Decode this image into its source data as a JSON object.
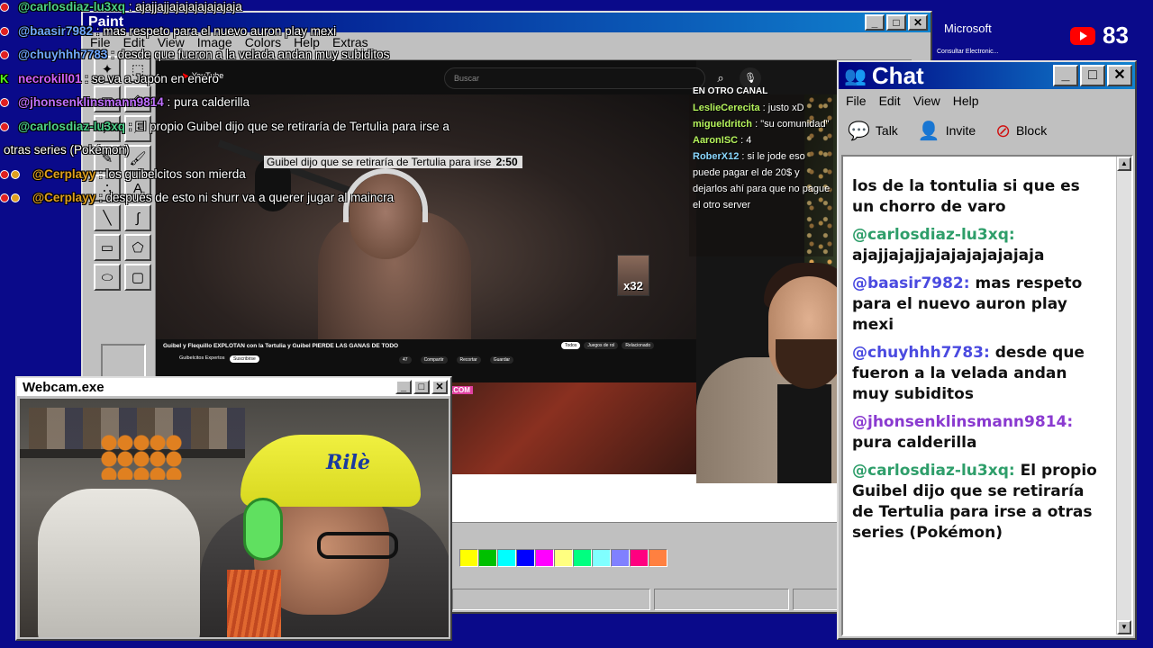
{
  "overlay_chat": [
    {
      "badge": "yt",
      "user": "@carlosdiaz-lu3xq",
      "user_color": "#4dd08a",
      "sep": " : ",
      "text": "ajajjajjajajajajajajaja"
    },
    {
      "badge": "yt",
      "user": "@baasir7982",
      "user_color": "#6fa8ff",
      "sep": " : ",
      "text": "mas respeto para el nuevo auron play mexi"
    },
    {
      "badge": "yt",
      "user": "@chuyhhh7783",
      "user_color": "#6fa8ff",
      "sep": " : ",
      "text": "desde que fueron a la velada andan muy subiditos"
    },
    {
      "badge": "kick",
      "user": "necrokill01",
      "user_color": "#d060ff",
      "sep": " : ",
      "text": "se va a Japón en enero"
    },
    {
      "badge": "yt",
      "user": "@jhonsenklinsmann9814",
      "user_color": "#c070ff",
      "sep": " : ",
      "text": "pura calderilla"
    },
    {
      "badge": "yt",
      "user": "@carlosdiaz-lu3xq",
      "user_color": "#4dd08a",
      "sep": " : ",
      "text": "El propio Guibel dijo que se retiraría de Tertulia para irse a"
    },
    {
      "badge": "none",
      "user": "",
      "user_color": "#ffffff",
      "sep": "",
      "text": "otras series (Pokémon)"
    },
    {
      "badge": "yt2",
      "user": "@Cerplayy",
      "user_color": "#e0a020",
      "sep": " : ",
      "text": "los guibelcitos son mierda"
    },
    {
      "badge": "yt2",
      "user": "@Cerplayy",
      "user_color": "#e0a020",
      "sep": " : ",
      "text": "después de esto ni shurr va a querer jugar al maincra"
    }
  ],
  "paint": {
    "title": "Paint",
    "menu": [
      "File",
      "Edit",
      "View",
      "Image",
      "Colors",
      "Help",
      "Extras"
    ],
    "palette": [
      "#ffff00",
      "#00c000",
      "#00ffff",
      "#0000ff",
      "#ff00ff",
      "#ffff80",
      "#00ff80",
      "#80ffff",
      "#8080ff",
      "#ff0080",
      "#ff8040"
    ]
  },
  "video": {
    "yt_logo": "YouTube",
    "search_placeholder": "Buscar",
    "subtitle": "Guibel dijo que se retiraría de Tertulia para irse",
    "subtitle_time": "2:50",
    "sticker": "x32",
    "video_title": "Guibel y Flequillo EXPLOTAN con la Tertulia y Guibel PIERDE LAS GANAS DE TODO",
    "channel": "Guibelcitos Expertos",
    "subscribe": "Suscribirse",
    "actions": [
      "47",
      "Compartir",
      "Recortar",
      "Guardar"
    ],
    "chips": [
      "Todos",
      "Juegos de rol",
      "Relacionado"
    ],
    "pink_label": ".COM"
  },
  "side_chat": {
    "header": "EN OTRO CANAL",
    "lines": [
      {
        "user": "LeslieCerecita",
        "text": "justo xD"
      },
      {
        "user": "migueldritch",
        "text": "\"su comunidad\""
      },
      {
        "user": "AaronISC",
        "text": "4"
      },
      {
        "user": "RoberX12",
        "text": "si le jode eso puede pagar el de 20$ y dejarlos ahí para que no pague el otro server"
      }
    ]
  },
  "webcam": {
    "title": "Webcam.exe",
    "cap_text": "Rilè"
  },
  "chat_window": {
    "title": "Chat",
    "menu": [
      "File",
      "Edit",
      "View",
      "Help"
    ],
    "tools": [
      {
        "icon": "talk-icon",
        "label": "Talk"
      },
      {
        "icon": "invite-icon",
        "label": "Invite"
      },
      {
        "icon": "block-icon",
        "label": "Block"
      }
    ],
    "messages": [
      {
        "user": "",
        "user_class": "",
        "text": "los de la tontulia si que es un chorro de varo"
      },
      {
        "user": "@carlosdiaz-lu3xq:",
        "user_class": "u-green",
        "text": "ajajjajajjajajajajajajaja"
      },
      {
        "user": "@baasir7982:",
        "user_class": "u-blue",
        "text": "mas respeto para el nuevo auron play mexi"
      },
      {
        "user": "@chuyhhh7783:",
        "user_class": "u-blue",
        "text": "desde que fueron a la velada andan muy subiditos"
      },
      {
        "user": "@jhonsenklinsmann9814:",
        "user_class": "u-purple",
        "text": "pura calderilla"
      },
      {
        "user": "@carlosdiaz-lu3xq:",
        "user_class": "u-green",
        "text": "El propio Guibel dijo que se retiraría de Tertulia para irse a otras series (Pokémon)"
      }
    ]
  },
  "top_right": {
    "ms_logo": "Microsoft",
    "ms_sub": "Consultar Electronic...",
    "viewer_count": "83"
  }
}
